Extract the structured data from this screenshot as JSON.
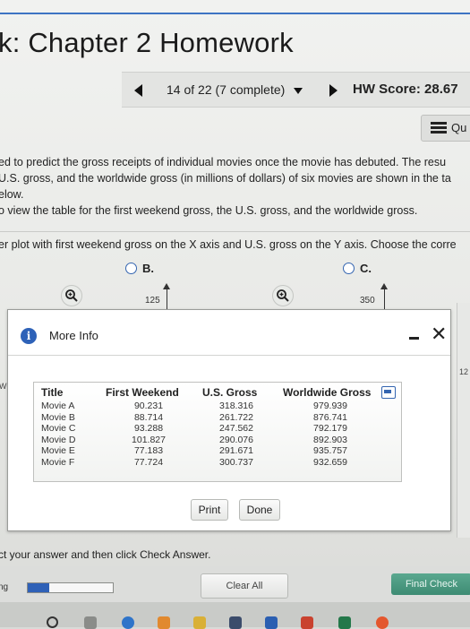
{
  "header": {
    "title": "k: Chapter 2 Homework",
    "progress_label": "14 of 22 (7 complete)",
    "hw_score": "HW Score: 28.67"
  },
  "question_button": {
    "label": "Qu"
  },
  "question_text": {
    "line1": "ed to predict the gross receipts of individual movies once the movie has debuted. The resu",
    "line2": "U.S. gross, and the worldwide gross (in millions of dollars) of six movies are shown in the ta",
    "line3": "elow.",
    "line4": "o view the table for the first weekend gross, the U.S. gross, and the worldwide gross.",
    "line5": "er plot with first weekend gross on the X axis and U.S. gross on the Y axis. Choose the corre"
  },
  "options": {
    "b": "B.",
    "c": "C."
  },
  "axes": {
    "b_ytick": "125",
    "c_ytick": "350",
    "side_label_left": "W",
    "side_label_right": "12"
  },
  "dialog": {
    "title": "More Info",
    "table": {
      "headers": [
        "Title",
        "First Weekend",
        "U.S. Gross",
        "Worldwide Gross"
      ],
      "titles": [
        "Movie A",
        "Movie B",
        "Movie C",
        "Movie D",
        "Movie E",
        "Movie F"
      ],
      "first_weekend": [
        "90.231",
        "88.714",
        "93.288",
        "101.827",
        "77.183",
        "77.724"
      ],
      "us_gross": [
        "318.316",
        "261.722",
        "247.562",
        "290.076",
        "291.671",
        "300.737"
      ],
      "worldwide_gross": [
        "979.939",
        "876.741",
        "792.179",
        "892.903",
        "935.757",
        "932.659"
      ]
    },
    "print_label": "Print",
    "done_label": "Done"
  },
  "instruction": "ct your answer and then click Check Answer.",
  "footer": {
    "ng_label": "ng",
    "progress_fraction": 0.25,
    "clear_all_label": "Clear All",
    "final_check_label": "Final Check"
  },
  "colors": {
    "accent_blue": "#2f61b7",
    "final_check_green": "#3e8b73"
  }
}
